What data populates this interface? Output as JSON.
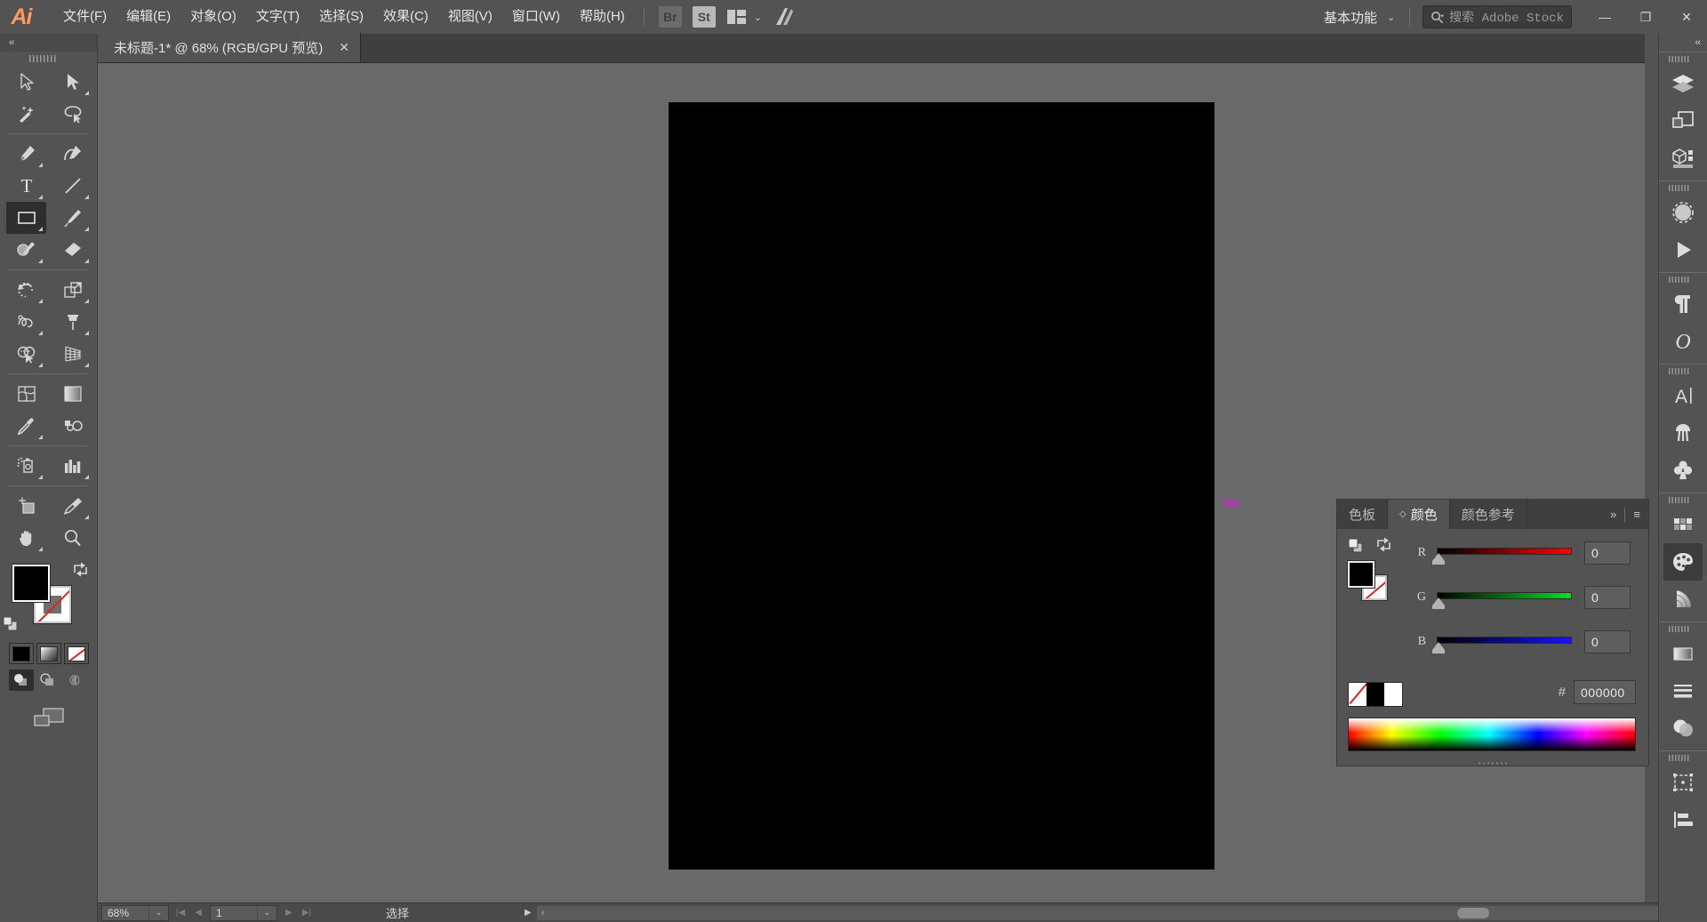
{
  "app": {
    "name": "Adobe Illustrator",
    "logo": "Ai"
  },
  "menu": {
    "items": [
      {
        "label": "文件(F)",
        "name": "menu-file"
      },
      {
        "label": "编辑(E)",
        "name": "menu-edit"
      },
      {
        "label": "对象(O)",
        "name": "menu-object"
      },
      {
        "label": "文字(T)",
        "name": "menu-type"
      },
      {
        "label": "选择(S)",
        "name": "menu-select"
      },
      {
        "label": "效果(C)",
        "name": "menu-effect"
      },
      {
        "label": "视图(V)",
        "name": "menu-view"
      },
      {
        "label": "窗口(W)",
        "name": "menu-window"
      },
      {
        "label": "帮助(H)",
        "name": "menu-help"
      }
    ]
  },
  "toolbar_apps": {
    "bridge": "Br",
    "stock": "St",
    "arrange_icon": "arrange-documents-icon",
    "stock_icon": "adobe-stock-icon"
  },
  "workspace": {
    "name": "基本功能",
    "chevron": "⌄"
  },
  "search": {
    "placeholder": "搜索 Adobe Stock",
    "cjk": "搜索",
    "latin": " Adobe Stock",
    "icon": "search-icon"
  },
  "window_controls": {
    "minimize": "—",
    "restore": "❐",
    "close": "✕"
  },
  "document_tab": {
    "title": "未标题-1* @ 68% (RGB/GPU 预览)",
    "close": "✕"
  },
  "tools": {
    "collapse": "‹‹",
    "items": [
      {
        "name": "selection-tool",
        "icon": "arrow-cursor",
        "corner": false,
        "active": false
      },
      {
        "name": "direct-selection-tool",
        "icon": "filled-arrow-cursor",
        "corner": true,
        "active": false
      },
      {
        "name": "magic-wand-tool",
        "icon": "magic-wand",
        "corner": false,
        "active": false
      },
      {
        "name": "lasso-tool",
        "icon": "lasso",
        "corner": false,
        "active": false
      },
      {
        "name": "pen-tool",
        "icon": "pen",
        "corner": true,
        "active": false
      },
      {
        "name": "curvature-tool",
        "icon": "curvature-pen",
        "corner": false,
        "active": false
      },
      {
        "name": "type-tool",
        "icon": "type-T",
        "corner": true,
        "active": false
      },
      {
        "name": "line-segment-tool",
        "icon": "line-segment",
        "corner": true,
        "active": false
      },
      {
        "name": "rectangle-tool",
        "icon": "rectangle",
        "corner": true,
        "active": true
      },
      {
        "name": "paintbrush-tool",
        "icon": "paintbrush",
        "corner": true,
        "active": false
      },
      {
        "name": "shaper-tool",
        "icon": "shaper-pencil",
        "corner": true,
        "active": false
      },
      {
        "name": "eraser-tool",
        "icon": "eraser",
        "corner": true,
        "active": false
      },
      {
        "name": "rotate-tool",
        "icon": "rotate",
        "corner": true,
        "active": false
      },
      {
        "name": "scale-tool",
        "icon": "scale",
        "corner": true,
        "active": false
      },
      {
        "name": "width-tool",
        "icon": "width-warp",
        "corner": true,
        "active": false
      },
      {
        "name": "free-transform-tool",
        "icon": "free-transform-pin",
        "corner": true,
        "active": false
      },
      {
        "name": "shape-builder-tool",
        "icon": "shape-builder",
        "corner": true,
        "active": false
      },
      {
        "name": "perspective-grid-tool",
        "icon": "perspective-grid",
        "corner": true,
        "active": false
      },
      {
        "name": "mesh-tool",
        "icon": "mesh",
        "corner": false,
        "active": false
      },
      {
        "name": "gradient-tool",
        "icon": "gradient",
        "corner": false,
        "active": false
      },
      {
        "name": "eyedropper-tool",
        "icon": "eyedropper",
        "corner": true,
        "active": false
      },
      {
        "name": "blend-tool",
        "icon": "blend",
        "corner": false,
        "active": false
      },
      {
        "name": "symbol-sprayer-tool",
        "icon": "symbol-sprayer",
        "corner": true,
        "active": false
      },
      {
        "name": "column-graph-tool",
        "icon": "column-graph",
        "corner": true,
        "active": false
      },
      {
        "name": "artboard-tool",
        "icon": "artboard",
        "corner": false,
        "active": false
      },
      {
        "name": "slice-tool",
        "icon": "slice-knife",
        "corner": true,
        "active": false
      },
      {
        "name": "hand-tool",
        "icon": "hand",
        "corner": true,
        "active": false
      },
      {
        "name": "zoom-tool",
        "icon": "magnifier",
        "corner": false,
        "active": false
      }
    ]
  },
  "fill_stroke": {
    "fill_color": "#000000",
    "stroke_color": "none",
    "swap_icon": "swap-arrow-icon",
    "default_icon": "default-fill-stroke-icon",
    "modes": [
      {
        "name": "color-mode-button",
        "icon": "solid-color-swatch",
        "active": true
      },
      {
        "name": "gradient-mode-button",
        "icon": "gradient-swatch",
        "active": false
      },
      {
        "name": "none-mode-button",
        "icon": "none-swatch",
        "active": false
      }
    ],
    "draw_modes": [
      {
        "name": "draw-normal-button",
        "icon": "draw-normal-icon",
        "active": true
      },
      {
        "name": "draw-behind-button",
        "icon": "draw-behind-icon",
        "active": false
      },
      {
        "name": "draw-inside-button",
        "icon": "draw-inside-icon",
        "active": false
      }
    ],
    "screen_mode": {
      "name": "change-screen-mode-button",
      "icon": "screen-mode-icon"
    }
  },
  "canvas": {
    "artboard_fill": "#000000",
    "background": "#696969",
    "smart_guide_label": "路径",
    "smart_guide_color": "#ff00ff"
  },
  "statusbar": {
    "zoom": "68%",
    "zoom_dropdown": "⌄",
    "page": "1",
    "page_dropdown": "⌄",
    "nav_first": "|◀",
    "nav_prev": "◀",
    "nav_next": "▶",
    "nav_last": "▶|",
    "status_text": "选择",
    "status_play": "▶",
    "hscroll_left": "‹",
    "hscroll_right": "›"
  },
  "right_dock": {
    "collapse": "‹‹",
    "groups": [
      {
        "items": [
          {
            "name": "layers-panel-icon",
            "icon": "layers",
            "active": false
          },
          {
            "name": "artboards-panel-icon",
            "icon": "artboards",
            "active": false
          },
          {
            "name": "properties-panel-icon",
            "icon": "properties-cube",
            "active": false
          }
        ]
      },
      {
        "items": [
          {
            "name": "transparency-panel-icon",
            "icon": "dashed-circle",
            "active": false
          },
          {
            "name": "actions-panel-icon",
            "icon": "play-triangle",
            "active": false
          }
        ]
      },
      {
        "items": [
          {
            "name": "paragraph-panel-icon",
            "icon": "pilcrow",
            "active": false
          },
          {
            "name": "glyphs-panel-icon",
            "icon": "glyph-O",
            "active": false
          }
        ]
      },
      {
        "items": [
          {
            "name": "character-panel-icon",
            "icon": "character-A",
            "active": false
          },
          {
            "name": "brushes-panel-icon",
            "icon": "brushes",
            "active": false
          },
          {
            "name": "symbols-panel-icon",
            "icon": "symbols-clover",
            "active": false
          }
        ]
      },
      {
        "items": [
          {
            "name": "swatches-panel-icon",
            "icon": "swatch-grid",
            "active": false
          },
          {
            "name": "color-panel-icon",
            "icon": "color-palette",
            "active": true
          },
          {
            "name": "color-guide-panel-icon",
            "icon": "color-guide-fan",
            "active": false
          }
        ]
      },
      {
        "items": [
          {
            "name": "gradient-panel-icon",
            "icon": "gradient-bar",
            "active": false
          },
          {
            "name": "stroke-panel-icon",
            "icon": "stroke-lines",
            "active": false
          },
          {
            "name": "pathfinder-panel-icon",
            "icon": "pathfinder-circles",
            "active": false
          }
        ]
      },
      {
        "items": [
          {
            "name": "transform-panel-icon",
            "icon": "transform-bbox",
            "active": false
          },
          {
            "name": "align-panel-icon",
            "icon": "align-left-icon",
            "active": false
          }
        ]
      }
    ]
  },
  "color_panel": {
    "tabs": [
      {
        "label": "色板",
        "name": "tab-swatches",
        "active": false,
        "has_dot": false
      },
      {
        "label": "颜色",
        "name": "tab-color",
        "active": true,
        "has_dot": true,
        "dot": "◇"
      },
      {
        "label": "颜色参考",
        "name": "tab-color-guide",
        "active": false,
        "has_dot": false
      }
    ],
    "expand_icon": "»",
    "menu_icon": "≡",
    "fill_color": "#000000",
    "stroke_color": "none",
    "swap_icon": "swap-arrow-icon",
    "mini_swap_icon": "fill-stroke-mini-icon",
    "sliders": [
      {
        "label": "R",
        "value": "0",
        "name": "red"
      },
      {
        "label": "G",
        "value": "0",
        "name": "green"
      },
      {
        "label": "B",
        "value": "0",
        "name": "blue"
      }
    ],
    "hex_symbol": "#",
    "hex_value": "000000",
    "quick_swatches": [
      {
        "name": "swatch-none",
        "kind": "none"
      },
      {
        "name": "swatch-black",
        "kind": "black"
      },
      {
        "name": "swatch-white",
        "kind": "white"
      }
    ]
  }
}
